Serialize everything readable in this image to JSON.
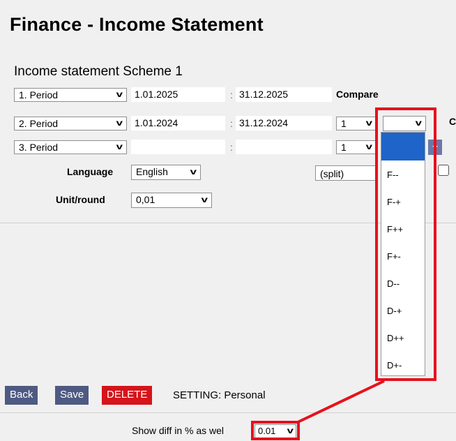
{
  "page": {
    "title": "Finance - Income Statement",
    "scheme_label": "Income statement Scheme 1"
  },
  "periods": [
    {
      "label": "1. Period",
      "from": "1.01.2025",
      "to": "31.12.2025"
    },
    {
      "label": "2. Period",
      "from": "1.01.2024",
      "to": "31.12.2024",
      "compare_value": "1",
      "compare_type": ""
    },
    {
      "label": "3. Period",
      "from": "",
      "to": "",
      "compare_value": "1"
    }
  ],
  "colon": ":",
  "compare_label": "Compare",
  "cut_label": "C",
  "language": {
    "label": "Language",
    "value": "English"
  },
  "unit": {
    "label": "Unit/round",
    "value": "0,01"
  },
  "split": {
    "value": "(split)"
  },
  "plus_label": "+",
  "compare_type_options": [
    "",
    "F--",
    "F-+",
    "F++",
    "F+-",
    "D--",
    "D-+",
    "D++",
    "D+-"
  ],
  "toolbar": {
    "back_label": "Back",
    "save_label": "Save",
    "delete_label": "DELETE",
    "setting_text": "SETTING: Personal"
  },
  "footer": {
    "diff_label": "Show diff in % as wel",
    "diff_value": "0.01"
  },
  "colors": {
    "highlight": "#e8101d",
    "selection": "#1f64c8",
    "button": "#4e5a82",
    "danger": "#d5141b"
  }
}
